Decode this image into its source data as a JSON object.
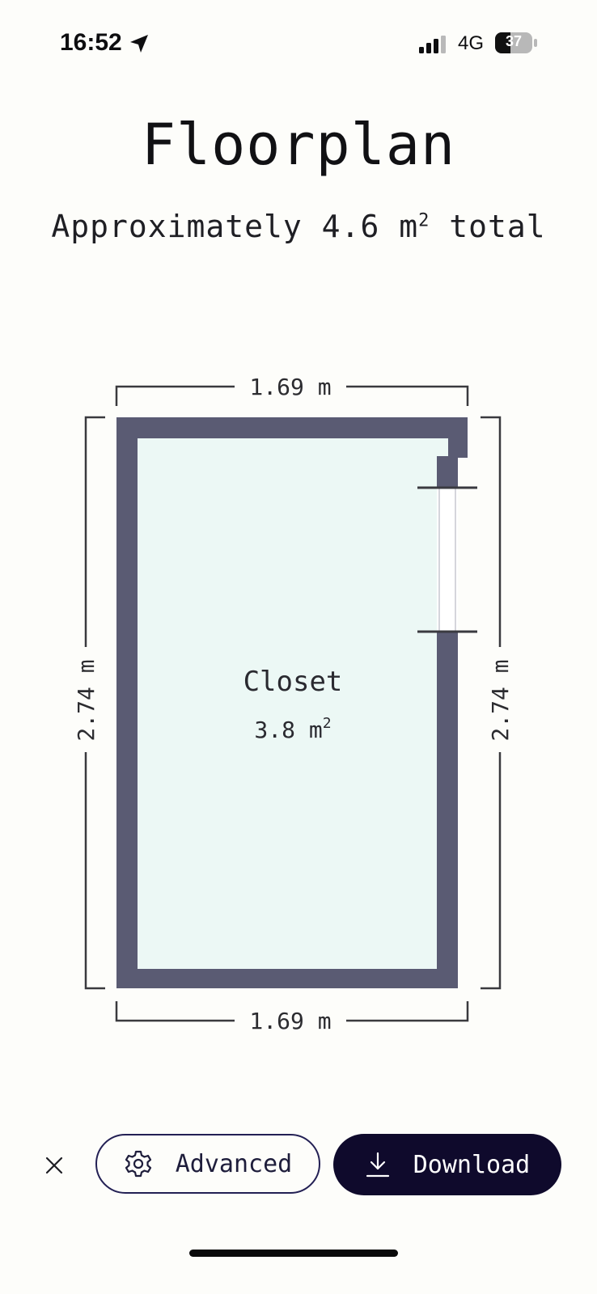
{
  "status_bar": {
    "time": "16:52",
    "network": "4G",
    "battery": "37",
    "icons": [
      "location-arrow-icon",
      "signal-icon",
      "battery-icon"
    ]
  },
  "header": {
    "title": "Floorplan",
    "subtitle_prefix": "Approximately 4.6 m",
    "subtitle_sup": "2",
    "subtitle_suffix": " total"
  },
  "floorplan": {
    "room": {
      "name": "Closet",
      "area_value": "3.8 m",
      "area_sup": "2"
    },
    "dimensions": {
      "top": "1.69 m",
      "bottom": "1.69 m",
      "left": "2.74 m",
      "right": "2.74 m"
    },
    "colors": {
      "wall": "#5a5b73",
      "floor": "#ecf8f5",
      "dimension_line": "#3a3a3e"
    }
  },
  "actions": {
    "close_icon": "close-icon",
    "advanced_label": "Advanced",
    "advanced_icon": "gear-icon",
    "download_label": "Download",
    "download_icon": "download-icon"
  }
}
